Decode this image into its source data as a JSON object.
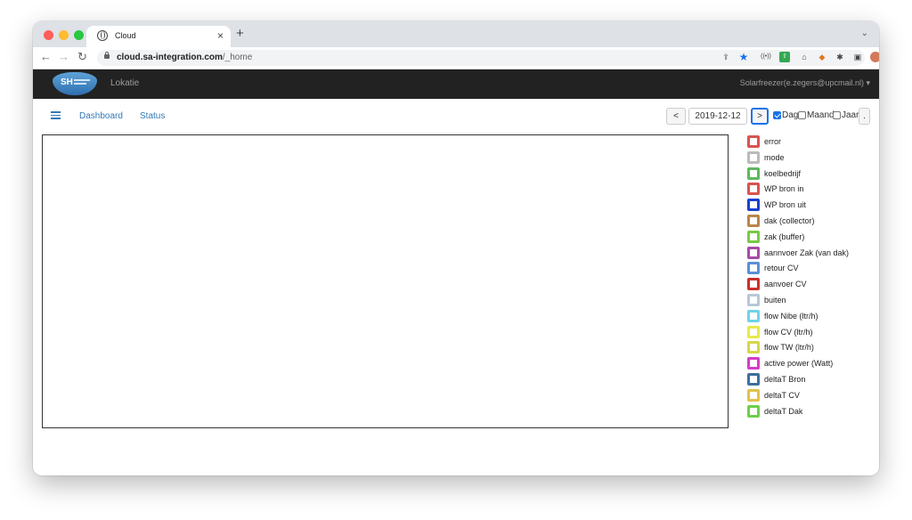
{
  "browser": {
    "tab_title": "Cloud",
    "url_host": "cloud.sa-integration.com",
    "url_path": "/_home"
  },
  "navbar": {
    "brand": "SH",
    "location_link": "Lokatie",
    "user_menu": "Solarfreezer(e.zegers@upcmail.nl)"
  },
  "subnav": {
    "dashboard": "Dashboard",
    "status": "Status",
    "prev_label": "<",
    "date": "2019-12-12",
    "next_label": ">",
    "period": {
      "dag": "Dag",
      "maand": "Maand",
      "jaar": "Jaar",
      "selected": "Dag"
    },
    "dot_label": "."
  },
  "legend": [
    {
      "label": "error",
      "color": "#d9534f"
    },
    {
      "label": "mode",
      "color": "#bbbbbb"
    },
    {
      "label": "koelbedrijf",
      "color": "#5cb85c"
    },
    {
      "label": "WP bron in",
      "color": "#d9534f"
    },
    {
      "label": "WP bron uit",
      "color": "#1a3fd1"
    },
    {
      "label": "dak (collector)",
      "color": "#b8864b"
    },
    {
      "label": "zak (buffer)",
      "color": "#7ac943"
    },
    {
      "label": "aannvoer Zak (van dak)",
      "color": "#a64ca6"
    },
    {
      "label": "retour CV",
      "color": "#5b8fd6"
    },
    {
      "label": "aanvoer CV",
      "color": "#c9302c"
    },
    {
      "label": "buiten",
      "color": "#b8c8d8"
    },
    {
      "label": "flow Nibe (ltr/h)",
      "color": "#6fd3e8"
    },
    {
      "label": "flow CV (ltr/h)",
      "color": "#e8e84c"
    },
    {
      "label": "flow TW (ltr/h)",
      "color": "#d6d64a"
    },
    {
      "label": "active power (Watt)",
      "color": "#d63cc6"
    },
    {
      "label": "deltaT Bron",
      "color": "#3d6f9c"
    },
    {
      "label": "deltaT CV",
      "color": "#e0c24a"
    },
    {
      "label": "deltaT Dak",
      "color": "#6ecf4a"
    }
  ]
}
